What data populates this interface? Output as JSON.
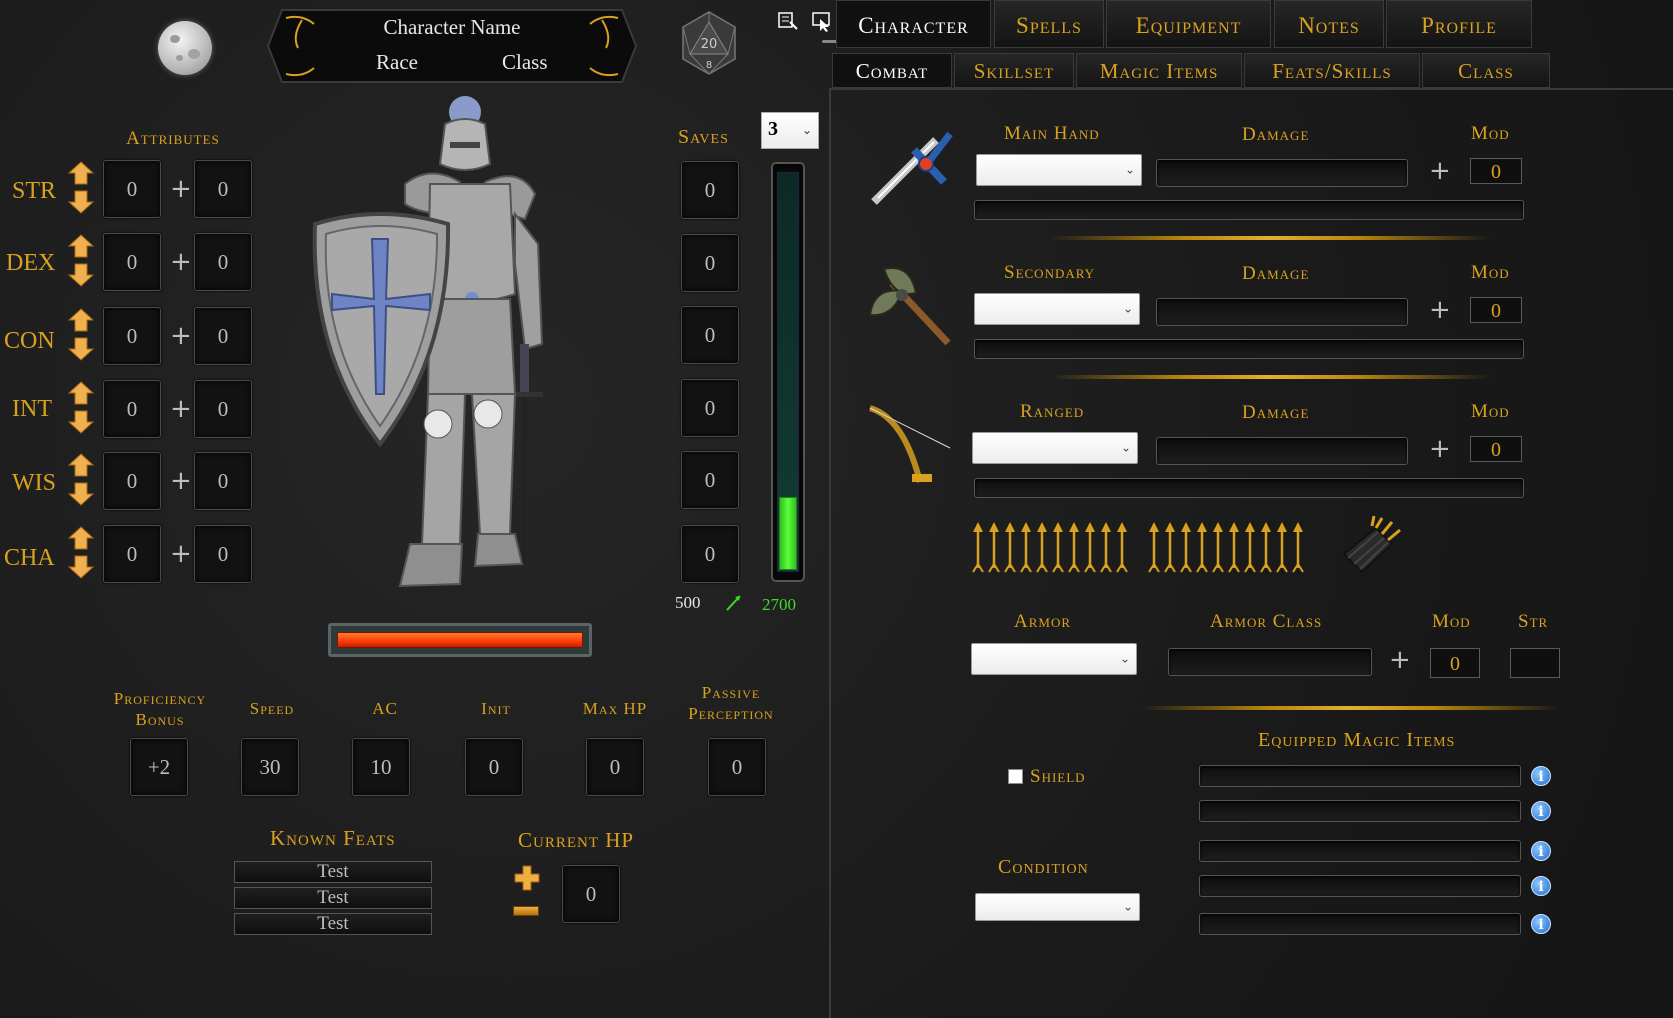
{
  "header": {
    "character_name": "Character Name",
    "race": "Race",
    "class": "Class"
  },
  "toolbar_icons": [
    "edit-icon",
    "pointer-icon",
    "frame-icon",
    "capture-icon"
  ],
  "attributes": {
    "title": "Attributes",
    "items": [
      {
        "label": "STR",
        "base": "0",
        "bonus": "0"
      },
      {
        "label": "DEX",
        "base": "0",
        "bonus": "0"
      },
      {
        "label": "CON",
        "base": "0",
        "bonus": "0"
      },
      {
        "label": "INT",
        "base": "0",
        "bonus": "0"
      },
      {
        "label": "WIS",
        "base": "0",
        "bonus": "0"
      },
      {
        "label": "CHA",
        "base": "0",
        "bonus": "0"
      }
    ]
  },
  "saves": {
    "title": "Saves",
    "level_select": "3",
    "values": [
      "0",
      "0",
      "0",
      "0",
      "0",
      "0"
    ],
    "xp_current": "500",
    "xp_next": "2700",
    "xp_progress": 0.185
  },
  "health_bar": {
    "fill": 1.0,
    "color": "#ff4a10"
  },
  "stats": [
    {
      "label": "Proficiency Bonus",
      "value": "+2"
    },
    {
      "label": "Speed",
      "value": "30"
    },
    {
      "label": "AC",
      "value": "10"
    },
    {
      "label": "Init",
      "value": "0"
    },
    {
      "label": "Max HP",
      "value": "0"
    },
    {
      "label": "Passive Perception",
      "value": "0"
    }
  ],
  "known_feats": {
    "title": "Known Feats",
    "items": [
      "Test",
      "Test",
      "Test"
    ]
  },
  "current_hp": {
    "title": "Current HP",
    "value": "0"
  },
  "main_tabs": [
    "Character",
    "Spells",
    "Equipment",
    "Notes",
    "Profile"
  ],
  "sub_tabs": [
    "Combat",
    "Skillset",
    "Magic Items",
    "Feats/Skills",
    "Class"
  ],
  "weapons": [
    {
      "slot_label": "Main Hand",
      "damage_label": "Damage",
      "mod_label": "Mod",
      "mod_value": "0",
      "icon": "sword-icon"
    },
    {
      "slot_label": "Secondary",
      "damage_label": "Damage",
      "mod_label": "Mod",
      "mod_value": "0",
      "icon": "axe-icon"
    },
    {
      "slot_label": "Ranged",
      "damage_label": "Damage",
      "mod_label": "Mod",
      "mod_value": "0",
      "icon": "bow-icon"
    }
  ],
  "ammo": {
    "arrow_count": 20,
    "icon": "quiver-icon"
  },
  "armor": {
    "armor_label": "Armor",
    "armor_class_label": "Armor Class",
    "mod_label": "Mod",
    "str_label": "Str",
    "mod_value": "0"
  },
  "magic_items": {
    "title": "Equipped Magic Items",
    "count": 5
  },
  "shield": {
    "label": "Shield",
    "checked": false
  },
  "condition": {
    "label": "Condition"
  },
  "colors": {
    "accent": "#d9a21e",
    "xp_fill": "#3ddc2a",
    "info": "#1f6fd1"
  }
}
